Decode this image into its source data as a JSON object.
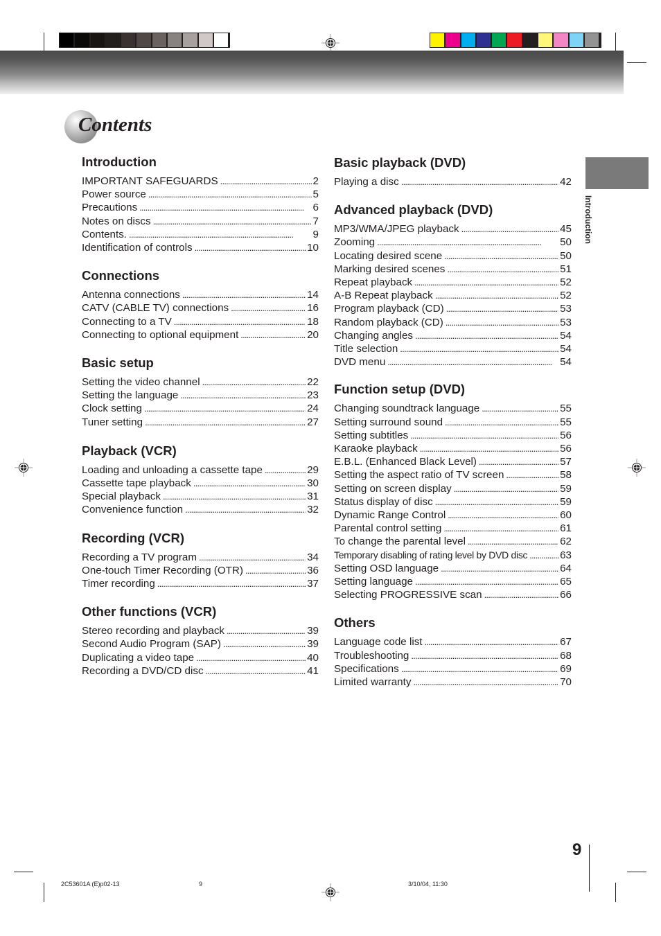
{
  "header": {
    "grayscale_swatches": [
      "#000000",
      "#0b0908",
      "#191513",
      "#231f1d",
      "#3a3230",
      "#504845",
      "#6a625f",
      "#888280",
      "#a8a09e",
      "#d0c9c8",
      "#ffffff"
    ],
    "color_swatches": [
      "#fff200",
      "#ec008c",
      "#00aeef",
      "#2e3192",
      "#00a651",
      "#ed1c24",
      "#231f20",
      "#fff67a",
      "#f386c4",
      "#7fd4f6",
      "#939393"
    ]
  },
  "title": "Contents",
  "side_tab": {
    "label": "Introduction",
    "color": "#7a7a7a"
  },
  "left_column": [
    {
      "title": "Introduction",
      "entries": [
        {
          "label": "IMPORTANT SAFEGUARDS",
          "page": "2"
        },
        {
          "label": "Power source",
          "page": "5"
        },
        {
          "label": "Precautions",
          "page": "6"
        },
        {
          "label": "Notes on discs",
          "page": "7"
        },
        {
          "label": "Contents.",
          "page": "9"
        },
        {
          "label": "Identification of controls",
          "page": "10"
        }
      ]
    },
    {
      "title": "Connections",
      "entries": [
        {
          "label": "Antenna connections",
          "page": "14"
        },
        {
          "label": "CATV (CABLE TV) connections",
          "page": "16"
        },
        {
          "label": "Connecting to a TV",
          "page": "18"
        },
        {
          "label": "Connecting to optional equipment",
          "page": "20"
        }
      ]
    },
    {
      "title": "Basic setup",
      "entries": [
        {
          "label": "Setting the video channel",
          "page": "22"
        },
        {
          "label": "Setting the language",
          "page": "23"
        },
        {
          "label": "Clock setting",
          "page": "24"
        },
        {
          "label": "Tuner setting",
          "page": "27"
        }
      ]
    },
    {
      "title": "Playback (VCR)",
      "entries": [
        {
          "label": "Loading and unloading a cassette tape",
          "page": "29"
        },
        {
          "label": "Cassette tape playback",
          "page": "30"
        },
        {
          "label": "Special playback",
          "page": "31"
        },
        {
          "label": "Convenience function",
          "page": "32"
        }
      ]
    },
    {
      "title": "Recording (VCR)",
      "entries": [
        {
          "label": "Recording a TV program",
          "page": "34"
        },
        {
          "label": "One-touch Timer Recording (OTR)",
          "page": "36"
        },
        {
          "label": "Timer recording",
          "page": "37"
        }
      ]
    },
    {
      "title": "Other functions (VCR)",
      "entries": [
        {
          "label": "Stereo recording and playback",
          "page": "39"
        },
        {
          "label": "Second Audio Program (SAP)",
          "page": "39"
        },
        {
          "label": "Duplicating a video tape",
          "page": "40"
        },
        {
          "label": "Recording a DVD/CD disc",
          "page": "41"
        }
      ]
    }
  ],
  "right_column": [
    {
      "title": "Basic playback (DVD)",
      "entries": [
        {
          "label": "Playing a disc",
          "page": "42"
        }
      ]
    },
    {
      "title": "Advanced playback (DVD)",
      "entries": [
        {
          "label": "MP3/WMA/JPEG playback",
          "page": "45"
        },
        {
          "label": "Zooming",
          "page": "50"
        },
        {
          "label": "Locating desired scene",
          "page": "50"
        },
        {
          "label": "Marking desired scenes",
          "page": "51"
        },
        {
          "label": "Repeat playback",
          "page": "52"
        },
        {
          "label": "A-B Repeat playback",
          "page": "52"
        },
        {
          "label": "Program playback (CD)",
          "page": "53"
        },
        {
          "label": "Random playback (CD)",
          "page": "53"
        },
        {
          "label": "Changing angles",
          "page": "54"
        },
        {
          "label": "Title selection",
          "page": "54"
        },
        {
          "label": "DVD menu",
          "page": "54"
        }
      ]
    },
    {
      "title": "Function setup (DVD)",
      "entries": [
        {
          "label": "Changing soundtrack language",
          "page": "55"
        },
        {
          "label": "Setting surround sound",
          "page": "55"
        },
        {
          "label": "Setting subtitles",
          "page": "56"
        },
        {
          "label": "Karaoke playback",
          "page": "56"
        },
        {
          "label": "E.B.L. (Enhanced Black Level)",
          "page": "57"
        },
        {
          "label": "Setting the aspect ratio of TV screen",
          "page": "58"
        },
        {
          "label": "Setting on screen display",
          "page": "59"
        },
        {
          "label": "Status display of disc",
          "page": "59"
        },
        {
          "label": "Dynamic Range Control",
          "page": "60"
        },
        {
          "label": "Parental control setting",
          "page": "61"
        },
        {
          "label": "To change the parental level",
          "page": "62"
        },
        {
          "label": "Temporary disabling of rating level by DVD disc",
          "page": "63",
          "small": true
        },
        {
          "label": "Setting OSD language",
          "page": "64"
        },
        {
          "label": "Setting language",
          "page": "65"
        },
        {
          "label": "Selecting PROGRESSIVE scan",
          "page": "66"
        }
      ]
    },
    {
      "title": "Others",
      "entries": [
        {
          "label": "Language code list",
          "page": "67"
        },
        {
          "label": "Troubleshooting",
          "page": "68"
        },
        {
          "label": "Specifications",
          "page": "69"
        },
        {
          "label": "Limited warranty",
          "page": "70"
        }
      ]
    }
  ],
  "page_number": "9",
  "footer": {
    "file_id": "2C53601A (E)p02-13",
    "page": "9",
    "timestamp": "3/10/04, 11:30"
  }
}
